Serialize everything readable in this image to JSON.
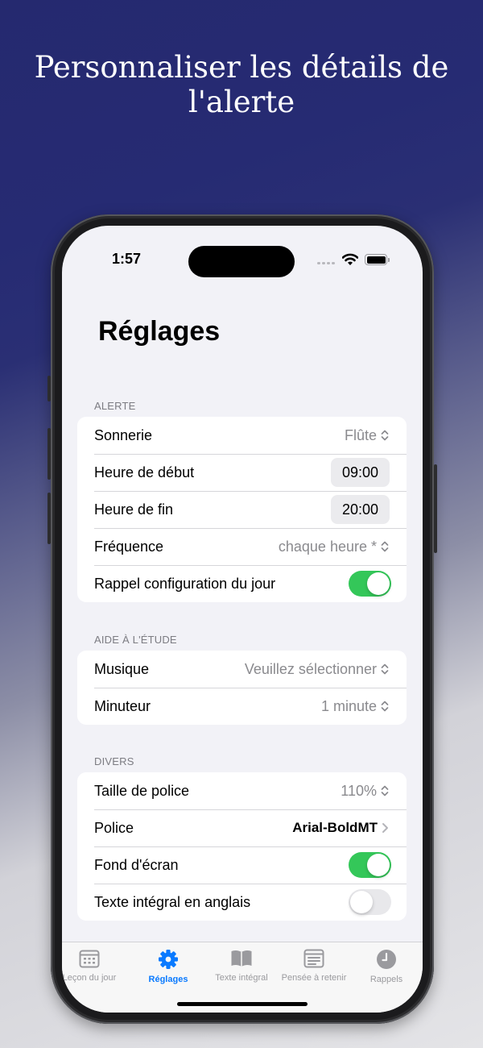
{
  "marketing": {
    "headline": "Personnaliser les détails de l'alerte"
  },
  "status_bar": {
    "time": "1:57"
  },
  "page": {
    "title": "Réglages"
  },
  "sections": {
    "alerte": {
      "header": "ALERTE",
      "sonnerie": {
        "label": "Sonnerie",
        "value": "Flûte"
      },
      "heure_debut": {
        "label": "Heure de début",
        "value": "09:00"
      },
      "heure_fin": {
        "label": "Heure de fin",
        "value": "20:00"
      },
      "frequence": {
        "label": "Fréquence",
        "value": "chaque heure *"
      },
      "rappel": {
        "label": "Rappel configuration du jour",
        "on": true
      }
    },
    "aide": {
      "header": "AIDE À L'ÉTUDE",
      "musique": {
        "label": "Musique",
        "value": "Veuillez sélectionner"
      },
      "minuteur": {
        "label": "Minuteur",
        "value": "1 minute"
      }
    },
    "divers": {
      "header": "DIVERS",
      "taille": {
        "label": "Taille de police",
        "value": "110%"
      },
      "police": {
        "label": "Police",
        "value": "Arial-BoldMT"
      },
      "fond": {
        "label": "Fond d'écran",
        "on": true
      },
      "texte_anglais": {
        "label": "Texte intégral en anglais",
        "on": false
      }
    }
  },
  "tabbar": {
    "items": [
      {
        "label": "Leçon du jour",
        "icon": "calendar-icon",
        "active": false
      },
      {
        "label": "Réglages",
        "icon": "gear-icon",
        "active": true
      },
      {
        "label": "Texte intégral",
        "icon": "book-icon",
        "active": false
      },
      {
        "label": "Pensée à retenir",
        "icon": "note-icon",
        "active": false
      },
      {
        "label": "Rappels",
        "icon": "clock-icon",
        "active": false
      }
    ]
  },
  "colors": {
    "accent": "#0a7aff",
    "toggle_on": "#34c759",
    "background_top": "#25296f",
    "grouped_background": "#f2f2f7"
  }
}
